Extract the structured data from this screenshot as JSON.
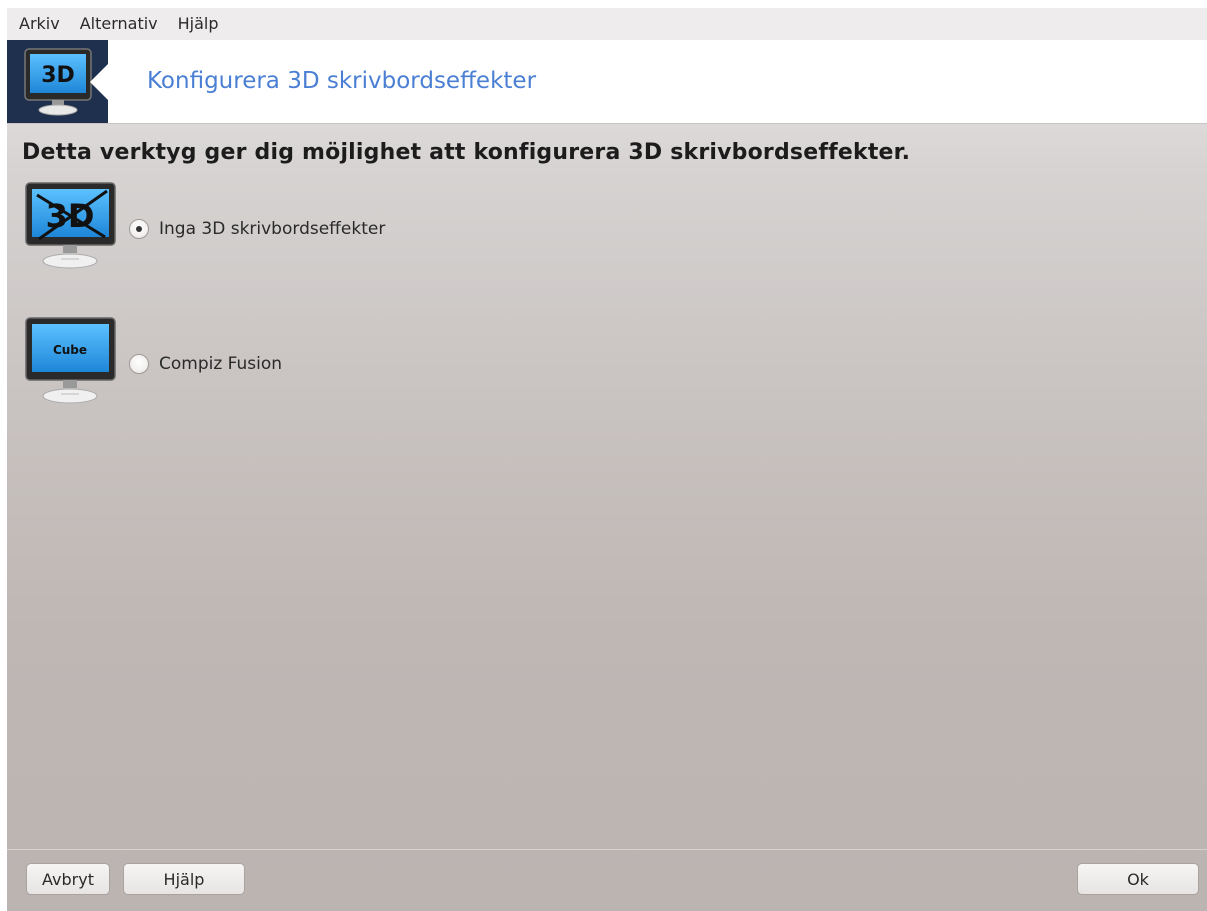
{
  "menu": {
    "items": [
      {
        "label": "Arkiv"
      },
      {
        "label": "Alternativ"
      },
      {
        "label": "Hjälp"
      }
    ]
  },
  "banner": {
    "icon_text": "3D",
    "title": "Konfigurera 3D skrivbordseffekter"
  },
  "main": {
    "intro": "Detta verktyg ger dig möjlighet att konfigurera 3D skrivbordseffekter.",
    "options": [
      {
        "label": "Inga 3D skrivbordseffekter",
        "icon_text": "3D",
        "selected": true
      },
      {
        "label": "Compiz Fusion",
        "icon_text": "Cube",
        "selected": false
      }
    ]
  },
  "footer": {
    "cancel_label": "Avbryt",
    "help_label": "Hjälp",
    "ok_label": "Ok"
  },
  "colors": {
    "banner_title": "#4a7fd4",
    "banner_icon_bg": "#1f2f4e",
    "screen_blue": "#2fa4ee"
  }
}
